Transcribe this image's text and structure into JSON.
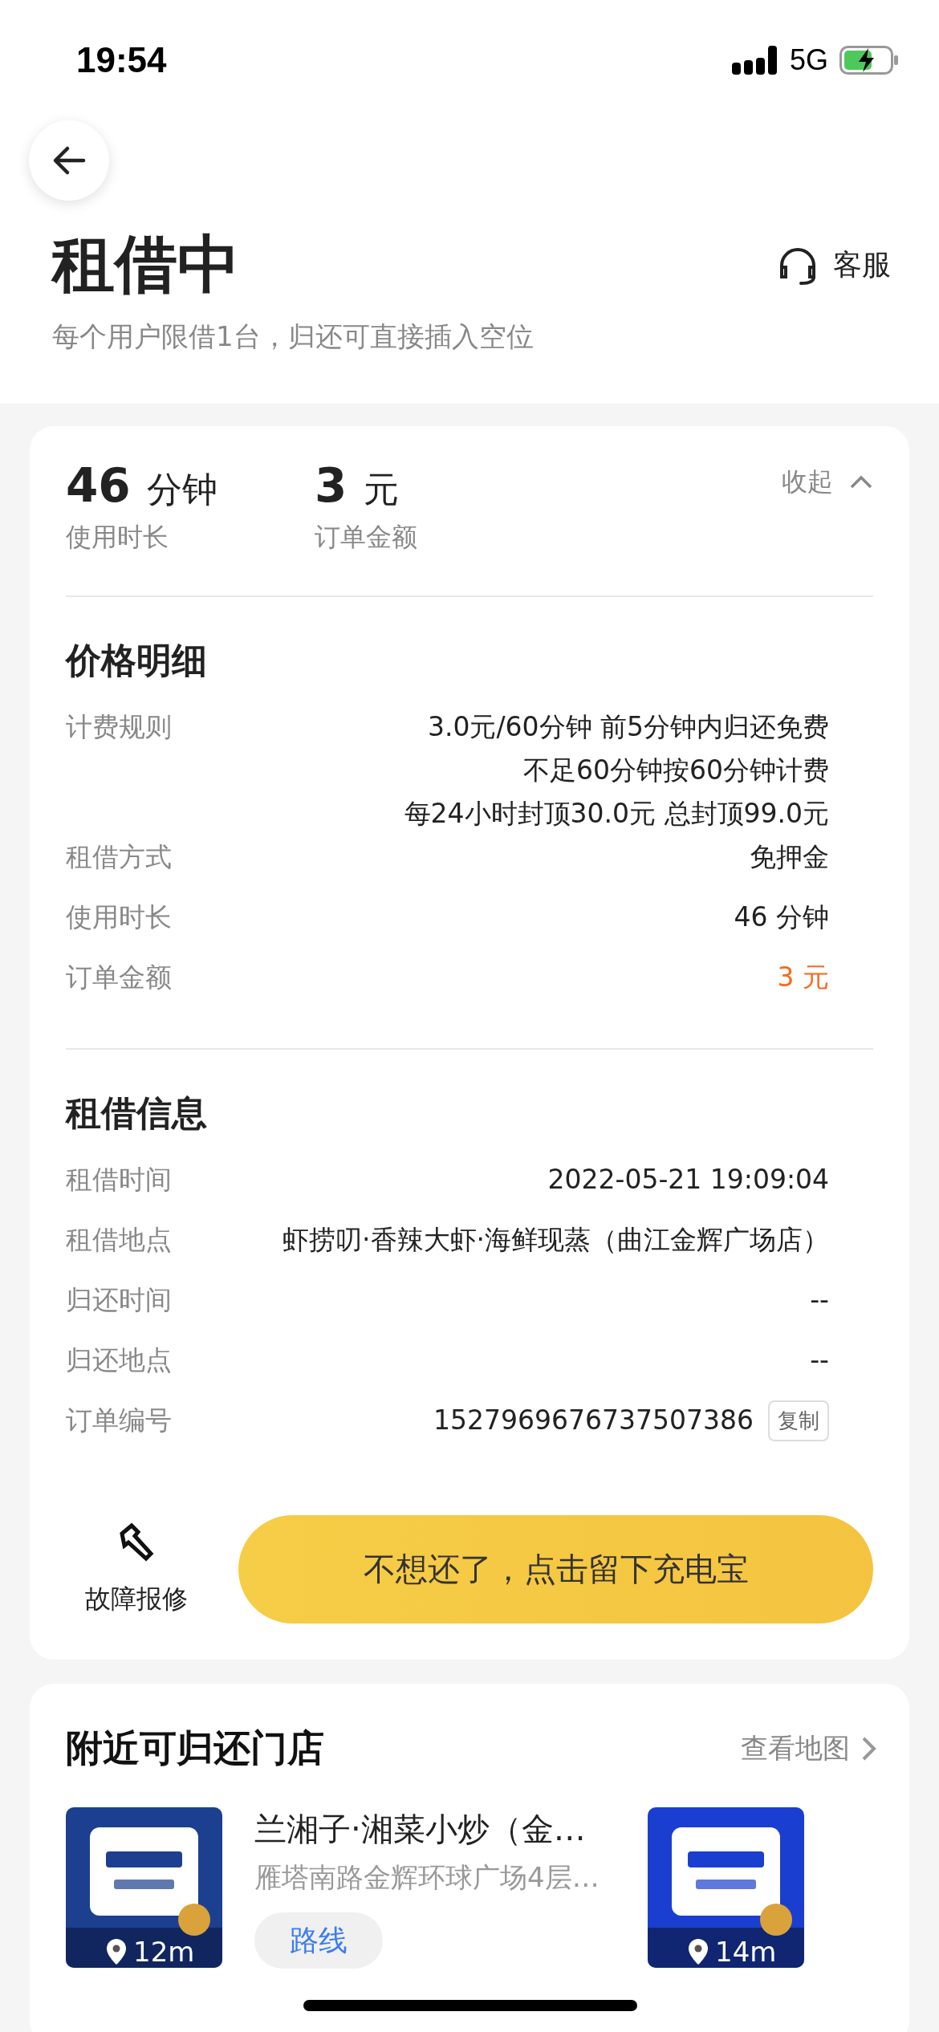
{
  "status_bar": {
    "time": "19:54",
    "network": "5G"
  },
  "header": {
    "title": "租借中",
    "subtitle": "每个用户限借1台，归还可直接插入空位",
    "service": "客服"
  },
  "summary": {
    "stats": [
      {
        "value": "46",
        "unit": "分钟",
        "label": "使用时长"
      },
      {
        "value": "3",
        "unit": "元",
        "label": "订单金额"
      }
    ],
    "collapse": "收起"
  },
  "price_details": {
    "title": "价格明细",
    "rows": [
      {
        "label": "计费规则",
        "lines": [
          "3.0元/60分钟 前5分钟内归还免费",
          "不足60分钟按60分钟计费",
          "每24小时封顶30.0元 总封顶99.0元"
        ],
        "highlight": false
      },
      {
        "label": "租借方式",
        "lines": [
          "免押金"
        ],
        "highlight": false
      },
      {
        "label": "使用时长",
        "lines": [
          "46 分钟"
        ],
        "highlight": false
      },
      {
        "label": "订单金额",
        "lines": [
          "3 元"
        ],
        "highlight": true
      }
    ]
  },
  "rental_info": {
    "title": "租借信息",
    "rows": [
      {
        "label": "租借时间",
        "value": "2022-05-21 19:09:04"
      },
      {
        "label": "租借地点",
        "value": "虾捞叨·香辣大虾·海鲜现蒸（曲江金辉广场店）"
      },
      {
        "label": "归还时间",
        "value": "--"
      },
      {
        "label": "归还地点",
        "value": "--"
      },
      {
        "label": "订单编号",
        "value": "1527969676737507386",
        "action": "复制"
      }
    ]
  },
  "actions": {
    "repair": "故障报修",
    "keep": "不想还了，点击留下充电宝"
  },
  "nearby": {
    "title": "附近可归还门店",
    "map_link": "查看地图",
    "stores": [
      {
        "name": "兰湘子·湘菜小炒（金…",
        "address": "雁塔南路金辉环球广场4层…",
        "distance": "12m",
        "route": "路线"
      },
      {
        "distance": "14m"
      }
    ]
  }
}
